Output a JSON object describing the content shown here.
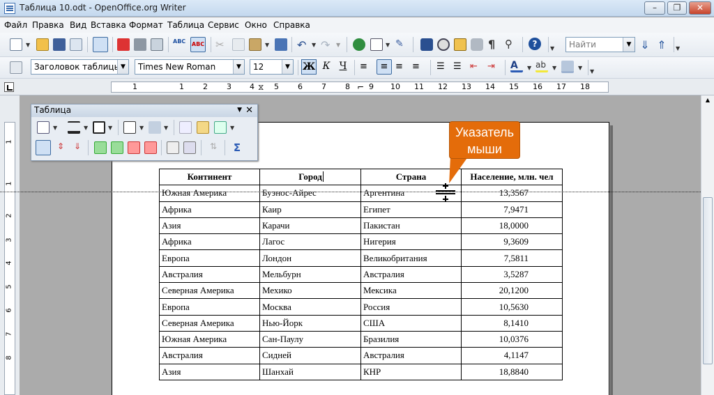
{
  "window": {
    "title": "Таблица 10.odt - OpenOffice.org Writer"
  },
  "menu": [
    "Файл",
    "Правка",
    "Вид",
    "Вставка",
    "Формат",
    "Таблица",
    "Сервис",
    "Окно",
    "Справка"
  ],
  "menu_underline": [
    "Ф",
    "П",
    "В",
    "В",
    "Ф",
    "Т",
    "С",
    "О",
    "С"
  ],
  "search": {
    "placeholder": "Найти"
  },
  "format": {
    "style": "Заголовок таблицы",
    "font": "Times New Roman",
    "size": "12",
    "bold": "Ж",
    "italic": "К",
    "underline": "Ч"
  },
  "ruler": {
    "numbers": [
      "1",
      "1",
      "2",
      "3",
      "4",
      "5",
      "6",
      "7",
      "8",
      "9",
      "10",
      "11",
      "12",
      "13",
      "14",
      "15",
      "16",
      "17",
      "18"
    ]
  },
  "vruler": {
    "numbers": [
      "1",
      "1",
      "2",
      "3",
      "4",
      "5",
      "6",
      "7",
      "8"
    ]
  },
  "table_toolbar": {
    "title": "Таблица"
  },
  "callout": {
    "line1": "Указатель",
    "line2": "мыши"
  },
  "table": {
    "headers": [
      "Континент",
      "Город",
      "Страна",
      "Население, млн. чел"
    ],
    "rows": [
      [
        "Южная Америка",
        "Буэнос-Айрес",
        "Аргентина",
        "13,3567"
      ],
      [
        "Африка",
        "Каир",
        "Египет",
        "7,9471"
      ],
      [
        "Азия",
        "Карачи",
        "Пакистан",
        "18,0000"
      ],
      [
        "Африка",
        "Лагос",
        "Нигерия",
        "9,3609"
      ],
      [
        "Европа",
        "Лондон",
        "Великобритания",
        "7,5811"
      ],
      [
        "Австралия",
        "Мельбурн",
        "Австралия",
        "3,5287"
      ],
      [
        "Северная Америка",
        "Мехико",
        "Мексика",
        "20,1200"
      ],
      [
        "Европа",
        "Москва",
        "Россия",
        "10,5630"
      ],
      [
        "Северная Америка",
        "Нью-Йорк",
        "США",
        "8,1410"
      ],
      [
        "Южная Америка",
        "Сан-Паулу",
        "Бразилия",
        "10,0376"
      ],
      [
        "Австралия",
        "Сидней",
        "Австралия",
        "4,1147"
      ],
      [
        "Азия",
        "Шанхай",
        "КНР",
        "18,8840"
      ]
    ]
  },
  "colors": {
    "callout": "#e46c0a",
    "titlebar": "#c4d8ee"
  }
}
